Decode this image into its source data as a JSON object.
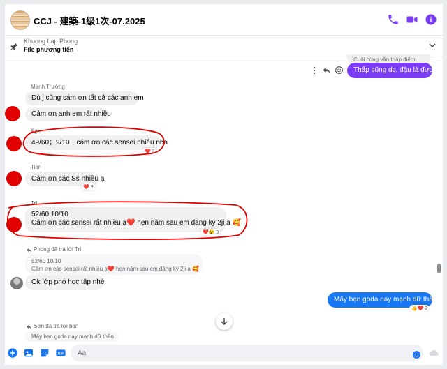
{
  "header": {
    "title": "CCJ - 建築-1級1次-07.2025"
  },
  "pinned": {
    "name": "Khuong Lap Phong",
    "label": "File phương tiện"
  },
  "colors": {
    "accent": "#7a3cf5",
    "blue_bubble": "#1877f2",
    "annotation_red": "#e00000"
  },
  "messages": {
    "top_partial": "Cuối cùng vẫn thấp điểm",
    "me_1": "Thấp cũng dc, đậu là được",
    "m1_sender": "Mạnh Trường",
    "m1_a": "Dù j cũng cám ơn tất cả các anh em",
    "m1_b": "Cảm ơn anh em rất nhiều",
    "m2_sender": "Ky",
    "m2_text": "49/60；9/10　cám ơn các sensei nhiều nha",
    "m2_react": "❤️ 2",
    "m3_sender": "Tien",
    "m3_text": "Cảm ơn các Ss nhiều ạ",
    "m3_react": "❤️ 3",
    "m4_sender": "Trí",
    "m4_line1": "52/60 10/10",
    "m4_line2": "Cảm ơn các sensei rất nhiều ạ❤️ hẹn năm sau em đăng ký 2ji ạ 🥰",
    "m4_react": "❤️😮 3",
    "m5_reply_label": "Phong đã trả lời Trí",
    "m5_quote_1": "52/60 10/10",
    "m5_quote_2": "Cảm ơn các sensei rất nhiều ạ❤️ hẹn năm sau em đăng ký 2ji ạ 🥰",
    "m5_text": "Ok lớp phó học tập nhé",
    "me_2": "Mấy bạn goda nay mạnh dữ thần",
    "me_2_react": "👍❤️ 2",
    "m6_reply_label": "Sơn đã trả lời bạn",
    "m6_quote": "Mấy bạn goda nay mạnh dữ thần"
  },
  "composer": {
    "placeholder": "Aa"
  },
  "icons": [
    "phone-icon",
    "video-icon",
    "info-icon",
    "pin-icon",
    "chevron-down-icon",
    "more-icon",
    "reply-icon",
    "emoji-icon",
    "scroll-down-icon",
    "plus-icon",
    "image-icon",
    "sticker-icon",
    "gif-icon",
    "emoji-icon",
    "cloud-icon"
  ]
}
